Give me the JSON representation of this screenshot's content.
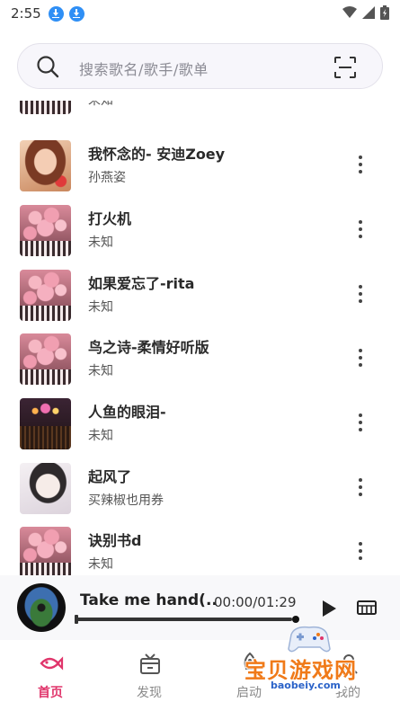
{
  "status_bar": {
    "time": "2:55"
  },
  "search": {
    "placeholder": "搜索歌名/歌手/歌单"
  },
  "songs": [
    {
      "title": "",
      "artist": "未知"
    },
    {
      "title": "我怀念的- 安迪Zoey",
      "artist": "孙燕姿"
    },
    {
      "title": "打火机",
      "artist": "未知"
    },
    {
      "title": "如果爱忘了-rita",
      "artist": "未知"
    },
    {
      "title": "鸟之诗-柔情好听版",
      "artist": "未知"
    },
    {
      "title": "人鱼的眼泪-",
      "artist": "未知"
    },
    {
      "title": "起风了",
      "artist": "买辣椒也用券"
    },
    {
      "title": "诀别书d",
      "artist": "未知"
    }
  ],
  "player": {
    "title": "Take me hand(..",
    "time": "00:00/01:29",
    "progress": 0.98
  },
  "nav": {
    "items": [
      {
        "label": "首页",
        "active": true
      },
      {
        "label": "发现",
        "active": false
      },
      {
        "label": "启动",
        "active": false
      },
      {
        "label": "我的",
        "active": false
      }
    ]
  },
  "watermark": {
    "text": "宝贝游戏网",
    "url": "baobeiy.com"
  },
  "colors": {
    "accent": "#e0356b",
    "download_badge": "#2f8ff5",
    "watermark_orange": "#f07a19"
  }
}
